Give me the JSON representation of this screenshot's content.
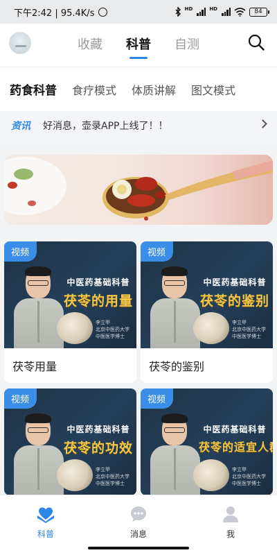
{
  "status_bar": {
    "time_speed": "下午2:42 | 95.4K/s",
    "network_label": "HD",
    "battery": "84"
  },
  "header": {
    "tabs": [
      {
        "label": "收藏",
        "active": false
      },
      {
        "label": "科普",
        "active": true
      },
      {
        "label": "自测",
        "active": false
      }
    ]
  },
  "sub_nav": {
    "items": [
      {
        "label": "药食科普",
        "active": true
      },
      {
        "label": "食疗模式",
        "active": false
      },
      {
        "label": "体质讲解",
        "active": false
      },
      {
        "label": "图文模式",
        "active": false
      }
    ]
  },
  "notice": {
    "tag": "资讯",
    "text": "好消息，壶录APP上线了！！"
  },
  "videos": [
    {
      "badge": "视频",
      "thumb_subtitle": "中医药基础科普",
      "thumb_title": "茯苓的用量",
      "label": "茯苓用量",
      "sign": [
        "李立甲",
        "北京中医药大学",
        "中医医学博士"
      ]
    },
    {
      "badge": "视频",
      "thumb_subtitle": "中医药基础科普",
      "thumb_title": "茯苓的鉴别",
      "label": "茯苓的鉴别",
      "sign": [
        "李立甲",
        "北京中医药大学",
        "中医医学博士"
      ]
    },
    {
      "badge": "视频",
      "thumb_subtitle": "中医药基础科普",
      "thumb_title": "茯苓的功效",
      "label": "",
      "sign": [
        "李立甲",
        "北京中医药大学",
        "中医医学博士"
      ]
    },
    {
      "badge": "视频",
      "thumb_subtitle": "中医药基础科普",
      "thumb_title": "茯苓的适宜人群",
      "label": "",
      "sign": [
        "李立甲",
        "北京中医药大学",
        "中医医学博士"
      ]
    }
  ],
  "bottom_nav": {
    "items": [
      {
        "label": "科普",
        "icon": "heart-hands-icon",
        "active": true
      },
      {
        "label": "消息",
        "icon": "chat-bubble-icon",
        "active": false
      },
      {
        "label": "我",
        "icon": "person-icon",
        "active": false
      }
    ]
  },
  "colors": {
    "accent": "#2e86e6",
    "thumb_title": "#f2c84b",
    "thumb_bg": "#1f3346"
  }
}
